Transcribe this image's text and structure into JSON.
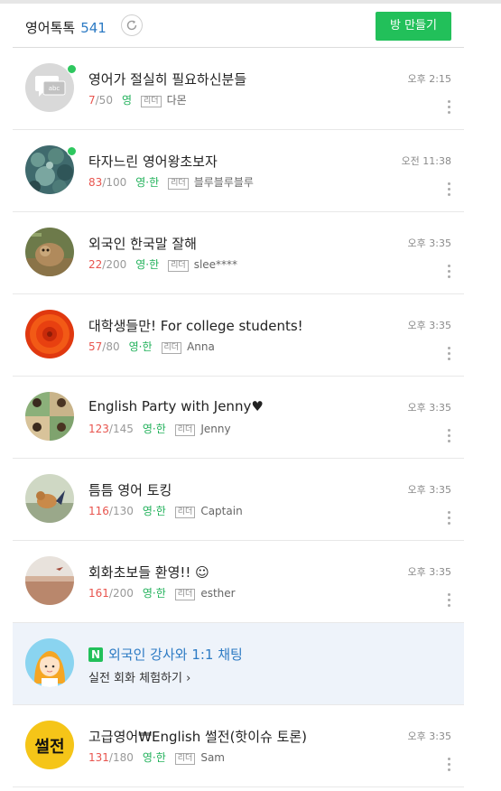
{
  "header": {
    "title": "영어톡톡",
    "count": "541",
    "make_room_label": "방 만들기"
  },
  "rooms": [
    {
      "name": "영어가 절실히 필요하신분들",
      "current": "7",
      "max": "/50",
      "lang": "영",
      "leader_badge": "리더",
      "leader": "다몬",
      "time": "오후 2:15"
    },
    {
      "name": "타자느린 영어왕초보자",
      "current": "83",
      "max": "/100",
      "lang": "영·한",
      "leader_badge": "리더",
      "leader": "블루블루블루",
      "time": "오전 11:38"
    },
    {
      "name": "외국인 한국말 잘해",
      "current": "22",
      "max": "/200",
      "lang": "영·한",
      "leader_badge": "리더",
      "leader": "slee****",
      "time": "오후 3:35"
    },
    {
      "name": "대학생들만! For college students!",
      "current": "57",
      "max": "/80",
      "lang": "영·한",
      "leader_badge": "리더",
      "leader": "Anna",
      "time": "오후 3:35"
    },
    {
      "name": "English Party with Jenny♥",
      "current": "123",
      "max": "/145",
      "lang": "영·한",
      "leader_badge": "리더",
      "leader": "Jenny",
      "time": "오후 3:35"
    },
    {
      "name": "틈틈 영어 토킹",
      "current": "116",
      "max": "/130",
      "lang": "영·한",
      "leader_badge": "리더",
      "leader": "Captain",
      "time": "오후 3:35"
    },
    {
      "name": "회화초보들 환영!! ☺",
      "current": "161",
      "max": "/200",
      "lang": "영·한",
      "leader_badge": "리더",
      "leader": "esther",
      "time": "오후 3:35"
    }
  ],
  "ad": {
    "icon_letter": "N",
    "title": "외국인 강사와 1:1 채팅",
    "subtitle": "실전 회화 체험하기",
    "chevron": "›"
  },
  "last_room": {
    "avatar_text": "썰전",
    "name": "고급영어₩English 썰전(핫이슈 토론)",
    "current": "131",
    "max": "/180",
    "lang": "영·한",
    "leader_badge": "리더",
    "leader": "Sam",
    "time": "오후 3:35"
  }
}
